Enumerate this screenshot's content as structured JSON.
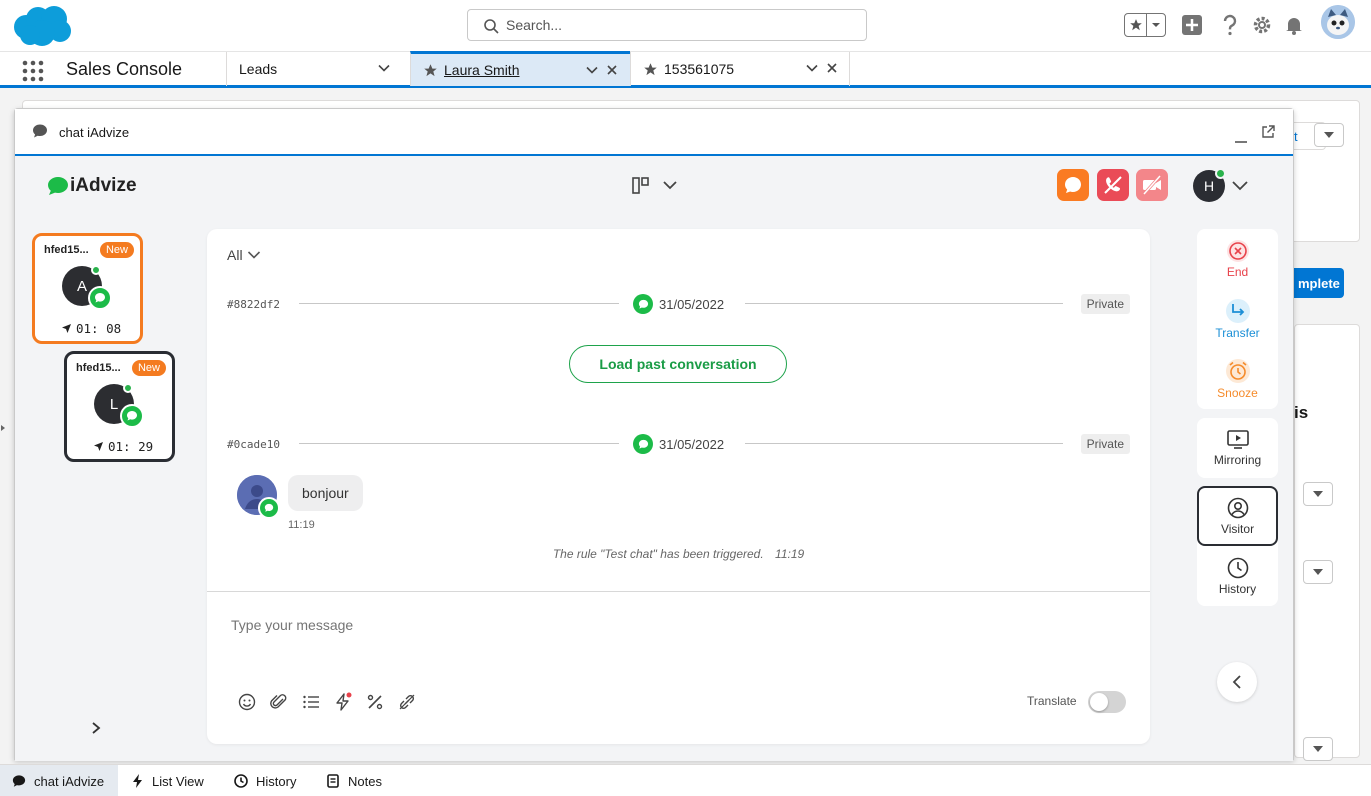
{
  "global_header": {
    "search_placeholder": "Search..."
  },
  "app_nav": {
    "app_name": "Sales Console",
    "tabs": [
      {
        "label": "Leads"
      },
      {
        "label": "Laura Smith"
      },
      {
        "label": "153561075"
      }
    ]
  },
  "background_page": {
    "button_fragment": "mplete",
    "heading_fragment": "is",
    "button_fragment_top": "t"
  },
  "chat_window": {
    "title": "chat iAdvize",
    "brand": "iAdvize",
    "user_initial": "H",
    "conversations": [
      {
        "visitor_id": "hfed15...",
        "badge": "New",
        "initial": "A",
        "time": "01: 08"
      },
      {
        "visitor_id": "hfed15...",
        "badge": "New",
        "initial": "L",
        "time": "01: 29"
      }
    ],
    "filter_label": "All",
    "threads": [
      {
        "id": "#8822df2",
        "date": "31/05/2022",
        "visibility": "Private"
      },
      {
        "id": "#0cade10",
        "date": "31/05/2022",
        "visibility": "Private"
      }
    ],
    "load_past_label": "Load past conversation",
    "message": {
      "text": "bonjour",
      "time": "11:19"
    },
    "system_note": "The rule \"Test chat\" has been triggered.",
    "system_note_time": "11:19",
    "composer_placeholder": "Type your message",
    "translate_label": "Translate",
    "translate_on": false,
    "actions": {
      "end": "End",
      "transfer": "Transfer",
      "snooze": "Snooze",
      "mirroring": "Mirroring",
      "visitor": "Visitor",
      "history": "History"
    },
    "colors": {
      "end": "#e8424b",
      "transfer": "#1c8fd6",
      "snooze": "#f58b2b",
      "brand_green": "#1cbb48",
      "status_chat": "#fa7b22",
      "status_phone": "#ea4b57",
      "status_video": "#f3868a"
    }
  },
  "utility_bar": {
    "items": [
      {
        "label": "chat iAdvize"
      },
      {
        "label": "List View"
      },
      {
        "label": "History"
      },
      {
        "label": "Notes"
      }
    ]
  }
}
